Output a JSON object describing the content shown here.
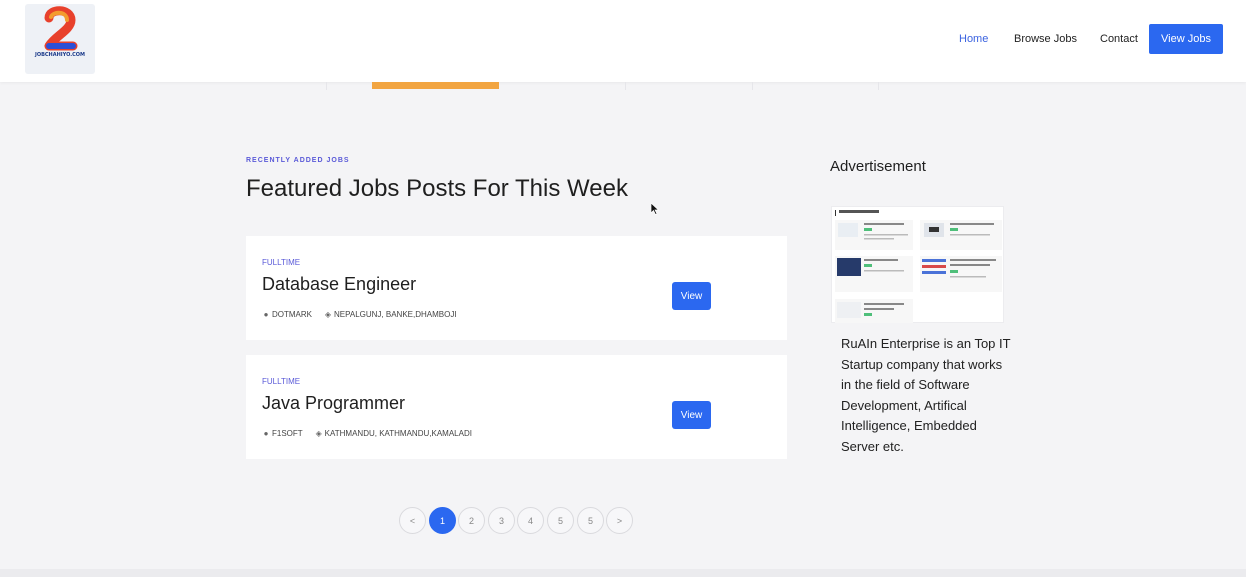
{
  "header": {
    "logo_text": "JOBCHAHIYO.COM",
    "nav": {
      "home": "Home",
      "browse_jobs": "Browse Jobs",
      "contact": "Contact",
      "view_jobs": "View Jobs"
    }
  },
  "section": {
    "eyebrow": "RECENTLY ADDED JOBS",
    "title": "Featured Jobs Posts For This Week"
  },
  "jobs": [
    {
      "type": "FULLTIME",
      "title": "Database Engineer",
      "company": "DOTMARK",
      "location": "NEPALGUNJ, BANKE,DHAMBOJI",
      "button": "View"
    },
    {
      "type": "FULLTIME",
      "title": "Java Programmer",
      "company": "F1SOFT",
      "location": "KATHMANDU, KATHMANDU,KAMALADI",
      "button": "View"
    }
  ],
  "pagination": {
    "prev": "<",
    "pages": [
      "1",
      "2",
      "3",
      "4",
      "5",
      "5"
    ],
    "next": ">",
    "active_page": "1"
  },
  "sidebar": {
    "ad_title": "Advertisement",
    "ad_text": "RuAIn Enterprise is an Top IT Startup company that works in the field of Software Development, Artifical Intelligence, Embedded Server etc."
  },
  "colors": {
    "accent": "#2b68f0",
    "eyebrow": "#5a5ad8",
    "tab_active": "#f2a541",
    "background": "#f4f4f6"
  },
  "icons": {
    "company": "company-icon",
    "location": "location-pin-icon"
  }
}
